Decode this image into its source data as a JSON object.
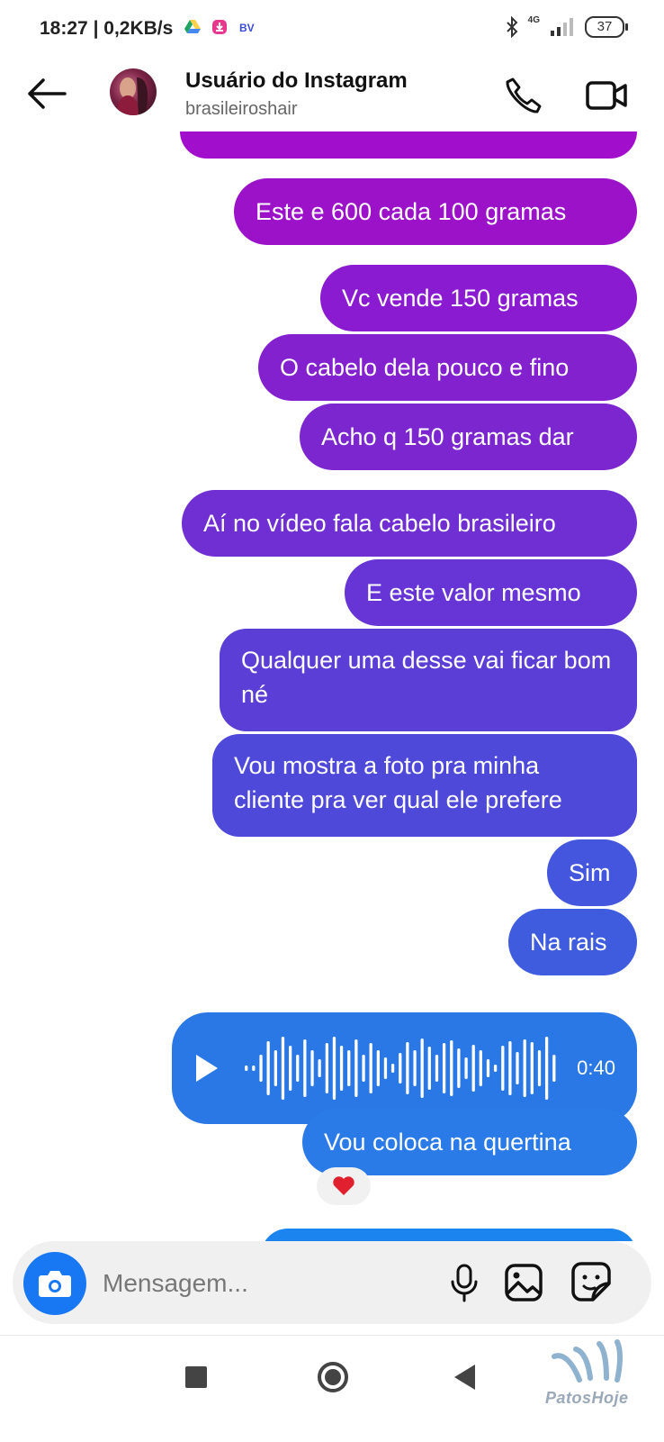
{
  "status_bar": {
    "time": "18:27",
    "network_speed": "| 0,2KB/s",
    "signal": "4G",
    "battery": "37"
  },
  "header": {
    "name": "Usuário do Instagram",
    "username": "brasileiroshair"
  },
  "messages": [
    {
      "text": "Este e 600 cada 100 gramas",
      "color": "#9b12c9"
    },
    {
      "text": "Vc vende 150 gramas",
      "color": "#8a1bd0"
    },
    {
      "text": "O cabelo dela pouco e fino",
      "color": "#8421cf"
    },
    {
      "text": "Acho q 150 gramas dar",
      "color": "#7c26cf"
    },
    {
      "text": "Aí no vídeo fala cabelo brasileiro",
      "color": "#6f2fd3"
    },
    {
      "text": "E este valor mesmo",
      "color": "#6735d5"
    },
    {
      "text": "Qualquer uma desse vai ficar bom né",
      "color": "#5b3ed6"
    },
    {
      "text": "Vou mostra a foto pra minha cliente pra ver qual ele prefere",
      "color": "#4f49da"
    },
    {
      "text": "Sim",
      "color": "#4456dd"
    },
    {
      "text": "Na rais",
      "color": "#3f5cdf"
    },
    {
      "text": "Vou coloca na quertina",
      "color": "#2a7ae8"
    }
  ],
  "voice_message": {
    "duration": "0:40",
    "color": "#2a78e6"
  },
  "reaction": {
    "emoji": "heart",
    "color": "#e0202e"
  },
  "composer": {
    "placeholder": "Mensagem..."
  },
  "watermark": {
    "text": "PatosHoje"
  },
  "colors": {
    "accent_blue": "#1877f2"
  }
}
